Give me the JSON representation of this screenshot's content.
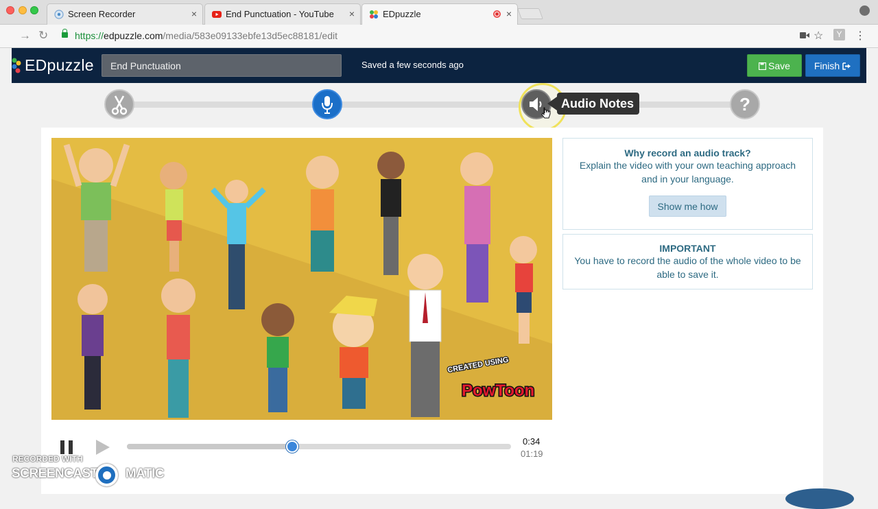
{
  "browser": {
    "tabs": [
      {
        "title": "Screen Recorder"
      },
      {
        "title": "End Punctuation - YouTube"
      },
      {
        "title": "EDpuzzle"
      }
    ],
    "close_glyph": "×",
    "url": {
      "scheme": "https://",
      "host": "edpuzzle.com",
      "path": "/media/583e09133ebfe13d5ec88181/edit"
    },
    "extension_label": "Y"
  },
  "app": {
    "logo": "EDpuzzle",
    "video_title": "End Punctuation",
    "save_status": "Saved a few seconds ago",
    "save_label": "Save",
    "finish_label": "Finish"
  },
  "steps": {
    "icons": [
      "scissors-icon",
      "microphone-icon",
      "speaker-icon",
      "question-icon"
    ],
    "help_glyph": "?",
    "tooltip": "Audio Notes"
  },
  "panels": {
    "why_title": "Why record an audio track?",
    "why_body_1": "Explain the video with your own teaching approach",
    "why_body_2": "and in your language.",
    "show_me_how": "Show me how",
    "important_title": "IMPORTANT",
    "important_body_1": "You have to record the audio of the whole video to be",
    "important_body_2": "able to save it."
  },
  "video": {
    "watermark_line1": "CREATED USING",
    "watermark_line2": "PowToon"
  },
  "player": {
    "current_time": "0:34",
    "total_time": "01:19",
    "progress_fraction": 0.43
  },
  "recording": {
    "line1": "RECORDED WITH",
    "line2a": "SCREENCAST",
    "line2b": "MATIC"
  },
  "colors": {
    "appbar": "#0c2340",
    "save": "#4cb34e",
    "finish": "#1f70c1",
    "accent": "#1b6fc8",
    "video_bg": "#e3bb42"
  }
}
